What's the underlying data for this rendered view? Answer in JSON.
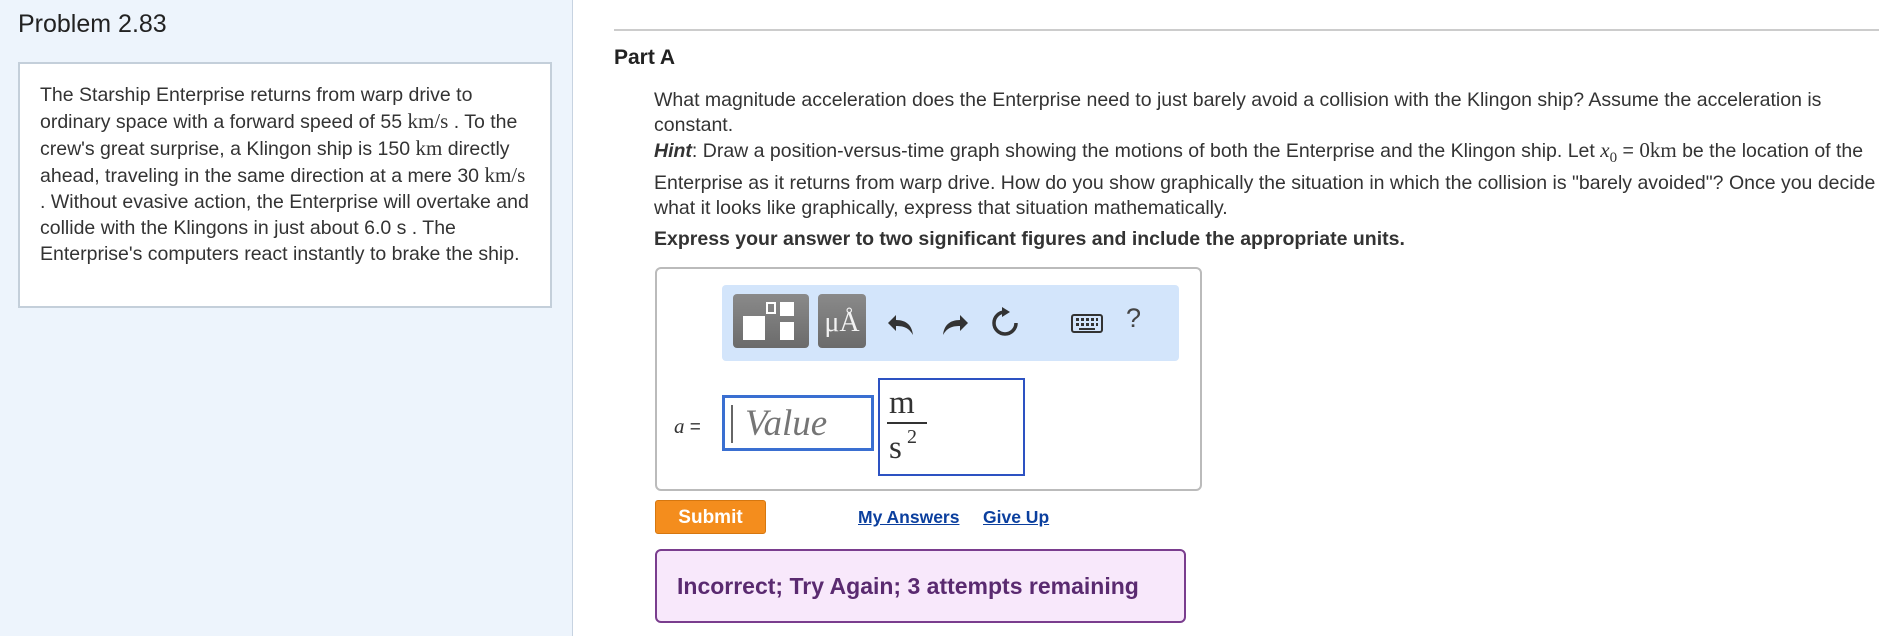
{
  "problem": {
    "title": "Problem 2.83",
    "text": {
      "p1": "The Starship Enterprise returns from warp drive to ordinary space with a forward speed of 55 ",
      "u1": "km/s",
      "p2": " . To the crew's great surprise, a Klingon ship is 150 ",
      "u2": "km",
      "p3": " directly ahead, traveling in the same direction at a mere 30 ",
      "u3": "km/s",
      "p4": " . Without evasive action, the Enterprise will overtake and collide with the Klingons in just about 6.0 s . The Enterprise's computers react instantly to brake the ship."
    }
  },
  "part": {
    "title": "Part A",
    "question": "What magnitude acceleration does the Enterprise need to just barely avoid a collision with the Klingon ship? Assume the acceleration is constant.",
    "hint_label": "Hint",
    "hint_p1": ": Draw a position-versus-time graph showing the motions of both the Enterprise and the Klingon ship. Let ",
    "hint_var": "x",
    "hint_sub": "0",
    "hint_eq": " = ",
    "hint_val": "0km",
    "hint_p2": " be the location of the Enterprise as it returns from warp drive. How do you show graphically the situation in which the collision is \"barely avoided\"? Once you decide what it looks like graphically, express that situation mathematically.",
    "instructions": "Express your answer to two significant figures and include the appropriate units."
  },
  "answer": {
    "toolbar": {
      "units_label": "μÅ",
      "help_label": "?",
      "icons": [
        "templates-icon",
        "units-icon",
        "undo-icon",
        "redo-icon",
        "reset-icon",
        "keyboard-icon",
        "help-icon"
      ]
    },
    "variable": "a",
    "equals": " =",
    "value_placeholder": "Value",
    "unit_numerator": "m",
    "unit_denominator": "s",
    "unit_exponent": "2"
  },
  "actions": {
    "submit_label": "Submit",
    "my_answers_label": "My Answers",
    "give_up_label": "Give Up"
  },
  "feedback": {
    "message": "Incorrect; Try Again; 3 attempts remaining"
  },
  "colors": {
    "submit": "#f48d1d",
    "link": "#0b3f9e",
    "feedback_border": "#7a3d8e",
    "feedback_bg": "#f8e8fb",
    "input_border": "#3a6fd1",
    "toolbar_bg": "#d3e5fb",
    "left_panel_bg": "#edf4fc"
  }
}
